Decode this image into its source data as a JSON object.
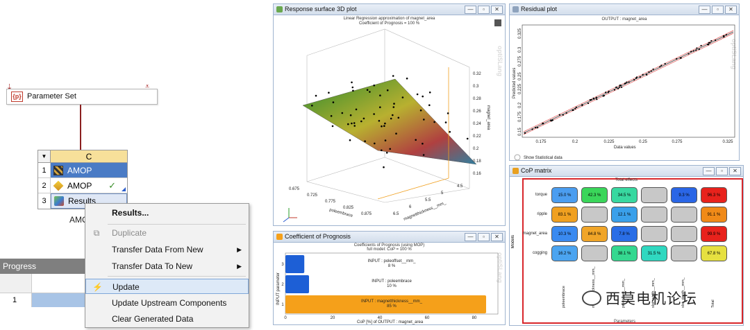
{
  "workbench": {
    "param_set": {
      "icon": "parameter-set-icon",
      "icon_text": "{p}",
      "label": "Parameter Set"
    },
    "system": {
      "column": "C",
      "name": "AMOP",
      "rows": [
        {
          "num": "1",
          "label": "AMOP",
          "icon": "checker-icon"
        },
        {
          "num": "2",
          "label": "AMOP",
          "icon": "diamond-icon",
          "status": "✓"
        },
        {
          "num": "3",
          "label": "Results",
          "icon": "results-icon"
        }
      ]
    },
    "progress": {
      "title": "Progress",
      "row_num": "1"
    }
  },
  "context_menu": {
    "items": [
      {
        "label": "Results...",
        "style": "bold"
      },
      {
        "label": "Duplicate",
        "style": "disabled",
        "icon": "duplicate-icon"
      },
      {
        "label": "Transfer Data From New",
        "submenu": "▶"
      },
      {
        "label": "Transfer Data To New",
        "submenu": "▶"
      },
      {
        "label": "Update",
        "style": "highlight",
        "icon": "lightning-icon"
      },
      {
        "label": "Update Upstream Components"
      },
      {
        "label": "Clear Generated Data"
      }
    ]
  },
  "windows": {
    "response": {
      "title": "Response surface 3D plot",
      "subtitle1": "Linear Regression  approximation of magnet_area",
      "subtitle2": "Coefficient of Prognosis = 100 %",
      "zlabel": "magnet_area",
      "xlabel": "poleembrace",
      "ylabel": "magnetthickness__mm_",
      "zticks": [
        "0.32",
        "0.3",
        "0.28",
        "0.26",
        "0.24",
        "0.22",
        "0.2",
        "0.18",
        "0.16"
      ],
      "xticks": [
        "0.675",
        "0.725",
        "0.775",
        "0.825",
        "0.875"
      ],
      "yticks": [
        "6.5",
        "6",
        "5.5",
        "5",
        "4.5"
      ],
      "watermark": "optiSLang"
    },
    "residual": {
      "title": "Residual plot",
      "subtitle": "OUTPUT : magnet_area",
      "ylabel": "Predicted values",
      "xlabel": "Data values",
      "xticks": [
        "0.175",
        "0.2",
        "0.225",
        "0.25",
        "0.275",
        "0.325"
      ],
      "yticks": [
        "0.15",
        "0.175",
        "0.2",
        "0.225",
        "0.25",
        "0.275",
        "0.3",
        "0.325"
      ],
      "checkbox": "Show Statistical data",
      "watermark": "optiSLang"
    },
    "cop": {
      "title": "CoP matrix",
      "top_label": "Total effects",
      "left_label": "Models",
      "bottom_label": "Parameters",
      "rows": [
        "torque",
        "ripple",
        "magnet_area",
        "cogging"
      ],
      "cols": [
        "poleembrace",
        "magnetthickness__mm_",
        "poleoffset__mm_",
        "slot_width__mm_",
        "slot_depth__mm_",
        "Total"
      ],
      "cells": [
        [
          "15.0 %",
          "42.3 %",
          "34.5 %",
          "",
          "9.3 %",
          "96.3 %"
        ],
        [
          "83.1 %",
          "",
          "12.1 %",
          "",
          "",
          "91.1 %"
        ],
        [
          "10.3 %",
          "84.8 %",
          "7.8 %",
          "",
          "",
          "99.9 %"
        ],
        [
          "16.2 %",
          "",
          "38.1 %",
          "31.5 %",
          "",
          "67.8 %"
        ]
      ],
      "colors": [
        [
          "#4b9df0",
          "#3ad65a",
          "#38d8a0",
          "#c8c8c8",
          "#2a66e6",
          "#e8221c"
        ],
        [
          "#f0a020",
          "#c8c8c8",
          "#3aa0ea",
          "#c8c8c8",
          "#c8c8c8",
          "#f08a18"
        ],
        [
          "#3a8af0",
          "#f0a528",
          "#2a6ee6",
          "#c8c8c8",
          "#c8c8c8",
          "#e8221c"
        ],
        [
          "#4ba4f0",
          "#c8c8c8",
          "#35d890",
          "#30d8c0",
          "#c8c8c8",
          "#e6e040"
        ]
      ]
    },
    "coef": {
      "title": "Coefficient of Prognosis",
      "subtitle1": "Coefficients of Prognosis (using MOP)",
      "subtitle2": "full model: CoP = 100 %",
      "ylabel": "INPUT parameter",
      "xlabel": "CoP [%] of OUTPUT : magnet_area",
      "xticks": [
        "0",
        "20",
        "40",
        "60",
        "80"
      ],
      "yticks": [
        "3",
        "2",
        "1"
      ],
      "bars": [
        {
          "label1": "INPUT : poleoffset__mm_",
          "label2": "8 %",
          "value": 8
        },
        {
          "label1": "INPUT : poleembrace",
          "label2": "10 %",
          "value": 10
        },
        {
          "label1": "INPUT : magnetthickness__mm_",
          "label2": "85 %",
          "value": 85
        }
      ],
      "watermark": "optiSLang"
    }
  },
  "footer": {
    "text": "西莫电机论坛"
  },
  "colors": {
    "accent": "#4a7bc5",
    "menu_hl": "#dde9f7",
    "red_frame": "#d8262a",
    "bar_orange": "#f5a01a",
    "bar_blue": "#1d5fd6"
  }
}
